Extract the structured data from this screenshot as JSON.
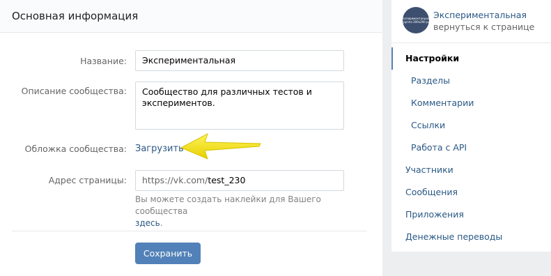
{
  "main": {
    "header_title": "Основная информация",
    "name_label": "Название:",
    "name_value": "Экспериментальная",
    "description_label": "Описание сообщества:",
    "description_value": "Сообщество для различных тестов и экспериментов.",
    "cover_label": "Обложка сообщества:",
    "cover_link": "Загрузить",
    "address_label": "Адрес страницы:",
    "address_prefix": "https://vk.com/",
    "address_value": "test_230",
    "hint_text": "Вы можете создать наклейки для Вашего сообщества",
    "hint_link": "здесь",
    "hint_tail": ".",
    "save_label": "Сохранить"
  },
  "sidebar": {
    "group_name": "Экспериментальная",
    "back_link": "вернуться к странице",
    "avatar_text": "Экспериментальная группа 200x200 px",
    "items": [
      {
        "label": "Настройки"
      },
      {
        "label": "Разделы"
      },
      {
        "label": "Комментарии"
      },
      {
        "label": "Ссылки"
      },
      {
        "label": "Работа с API"
      },
      {
        "label": "Участники"
      },
      {
        "label": "Сообщения"
      },
      {
        "label": "Приложения"
      },
      {
        "label": "Денежные переводы"
      }
    ]
  },
  "colors": {
    "accent": "#5181b8",
    "link": "#2a5885",
    "arrow": "#f5e400"
  }
}
